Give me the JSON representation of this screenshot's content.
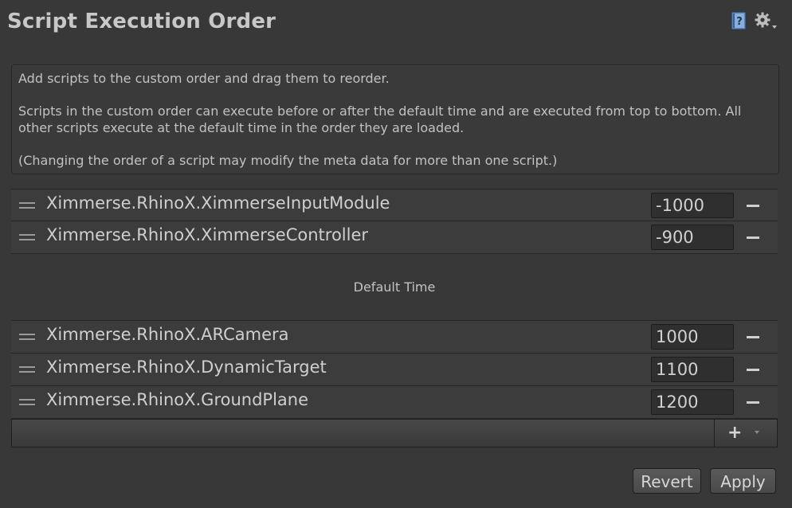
{
  "header": {
    "title": "Script Execution Order",
    "help_icon": "help-book-icon",
    "settings_icon": "gear-dropdown-icon"
  },
  "info": {
    "line1": "Add scripts to the custom order and drag them to reorder.",
    "line2": "Scripts in the custom order can execute before or after the default time and are executed from top to bottom. All other scripts execute at the default time in the order they are loaded.",
    "line3": "(Changing the order of a script may modify the meta data for more than one script.)"
  },
  "scripts_before": [
    {
      "name": "Ximmerse.RhinoX.XimmerseInputModule",
      "order": "-1000"
    },
    {
      "name": "Ximmerse.RhinoX.XimmerseController",
      "order": "-900"
    }
  ],
  "default_time_label": "Default Time",
  "scripts_after": [
    {
      "name": "Ximmerse.RhinoX.ARCamera",
      "order": "1000"
    },
    {
      "name": "Ximmerse.RhinoX.DynamicTarget",
      "order": "1100"
    },
    {
      "name": "Ximmerse.RhinoX.GroundPlane",
      "order": "1200"
    }
  ],
  "footer": {
    "add_label": "+"
  },
  "buttons": {
    "revert": "Revert",
    "apply": "Apply"
  },
  "colors": {
    "background": "#383838",
    "row_background": "#3c3c3c",
    "field_background": "#2f2f2f",
    "text": "#c4c4c4"
  }
}
